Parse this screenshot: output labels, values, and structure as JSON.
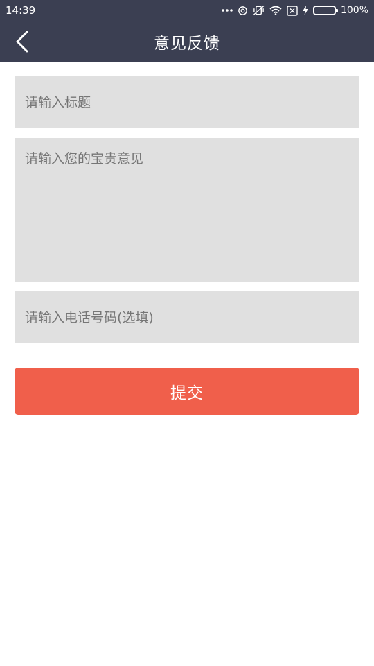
{
  "status_bar": {
    "time": "14:39",
    "battery_percent_label": "100%",
    "battery_level": 1.0,
    "icons": [
      "more-dots-icon",
      "sync-icon",
      "vibrate-icon",
      "wifi-icon",
      "sim-off-icon",
      "charging-icon",
      "battery-icon"
    ]
  },
  "header": {
    "title": "意见反馈",
    "back_icon": "chevron-left-icon"
  },
  "form": {
    "title_placeholder": "请输入标题",
    "title_value": "",
    "content_placeholder": "请输入您的宝贵意见",
    "content_value": "",
    "phone_placeholder": "请输入电话号码(选填)",
    "phone_value": "",
    "submit_label": "提交"
  },
  "colors": {
    "header_bg": "#3b3f52",
    "field_bg": "#e0e0e0",
    "accent": "#f05f4b",
    "battery_green": "#2fd24a"
  }
}
